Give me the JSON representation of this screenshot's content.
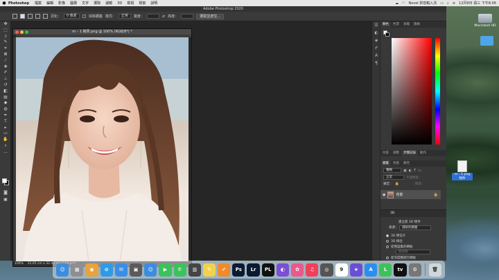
{
  "menubar": {
    "app_name": "Photoshop",
    "menus": [
      "檔案",
      "編輯",
      "影像",
      "圖層",
      "文字",
      "選取",
      "濾鏡",
      "3D",
      "檢視",
      "視窗",
      "說明"
    ],
    "clock": "12月9日 週三 下午8:06",
    "status_label": "Novel 拼音輸入法"
  },
  "ps": {
    "title": "Adobe Photoshop 2020",
    "options": {
      "feather_label": "羽化：",
      "feather_value": "0 像素",
      "antialias_label": "消除鋸齒",
      "style_label": "樣式：",
      "style_value": "正常",
      "width_label": "寬度：",
      "height_label": "高度：",
      "select_mask_button": "選取並遮住..."
    },
    "document": {
      "title": "m – 1 拷貝.png @ 100% (RGB/8*) *",
      "zoom": "100%",
      "doc_size": "25.05 cm x 32.46 cm (144 ppi)"
    },
    "color_panel": {
      "tabs": [
        "顏色",
        "色票",
        "漸層",
        "圖樣"
      ],
      "fg_color": "#ffffff",
      "bg_color": "#000000"
    },
    "history_panel": {
      "tabs": [
        "內容",
        "調整",
        "步驟記錄",
        "動作"
      ],
      "active": "步驟記錄"
    },
    "layers_panel": {
      "tabs": [
        "圖層",
        "色版",
        "路徑"
      ],
      "filter_placeholder": "種類",
      "blend_mode": "正常",
      "opacity_label": "不透明度：",
      "lock_label": "鎖定：",
      "fill_label": "填滿：",
      "layer_name": "背景"
    },
    "threed_panel": {
      "title": "3D",
      "create_label": "建立新 3D 物件",
      "source_label": "來源：",
      "source_value": "選取的圖層",
      "options": [
        "3D 明信片",
        "3D 擠出",
        "從預設集的網紋",
        "從深度圖進行網紋"
      ],
      "preset_value": "甜甜圈",
      "selected": 0
    }
  },
  "desktop": {
    "hd_label": "Macintosh HD",
    "file_label": "m – 1.png 物件"
  },
  "dock": {
    "items": [
      {
        "name": "finder",
        "label": "☺",
        "color": "#3b8de0"
      },
      {
        "name": "launchpad",
        "label": "▦",
        "color": "#8e8e93"
      },
      {
        "name": "chrome",
        "label": "◉",
        "color": "#e8a33d"
      },
      {
        "name": "safari",
        "label": "⊘",
        "color": "#2e9be6"
      },
      {
        "name": "mail",
        "label": "✉",
        "color": "#3a8ee6"
      },
      {
        "name": "photo-booth",
        "label": "▣",
        "color": "#5a5a5a"
      },
      {
        "name": "finder-2",
        "label": "☺",
        "color": "#3b8de0"
      },
      {
        "name": "facetime",
        "label": "▶",
        "color": "#3cc25a"
      },
      {
        "name": "messages",
        "label": "✆",
        "color": "#3cc25a"
      },
      {
        "name": "calculator",
        "label": "▥",
        "color": "#444"
      },
      {
        "name": "notes",
        "label": "✎",
        "color": "#f2d24b"
      },
      {
        "name": "pages",
        "label": "✐",
        "color": "#f08a2a"
      },
      {
        "name": "photoshop",
        "label": "Ps",
        "color": "#0b1a33"
      },
      {
        "name": "lightroom",
        "label": "Lr",
        "color": "#0b1a33"
      },
      {
        "name": "pl",
        "label": "PL",
        "color": "#111"
      },
      {
        "name": "siri",
        "label": "◐",
        "color": "#7b4fd6"
      },
      {
        "name": "photos",
        "label": "✿",
        "color": "#e85a8a"
      },
      {
        "name": "music",
        "label": "♫",
        "color": "#f0405a"
      },
      {
        "name": "camera",
        "label": "◎",
        "color": "#555"
      },
      {
        "name": "calendar",
        "label": "9",
        "color": "#ffffff"
      },
      {
        "name": "imovie",
        "label": "★",
        "color": "#6a4fd6"
      },
      {
        "name": "appstore",
        "label": "A",
        "color": "#2a8ef0"
      },
      {
        "name": "line",
        "label": "L",
        "color": "#3cc25a"
      },
      {
        "name": "appletv",
        "label": "tv",
        "color": "#111"
      },
      {
        "name": "settings",
        "label": "⚙",
        "color": "#777"
      }
    ],
    "trash_label": "🗑"
  }
}
